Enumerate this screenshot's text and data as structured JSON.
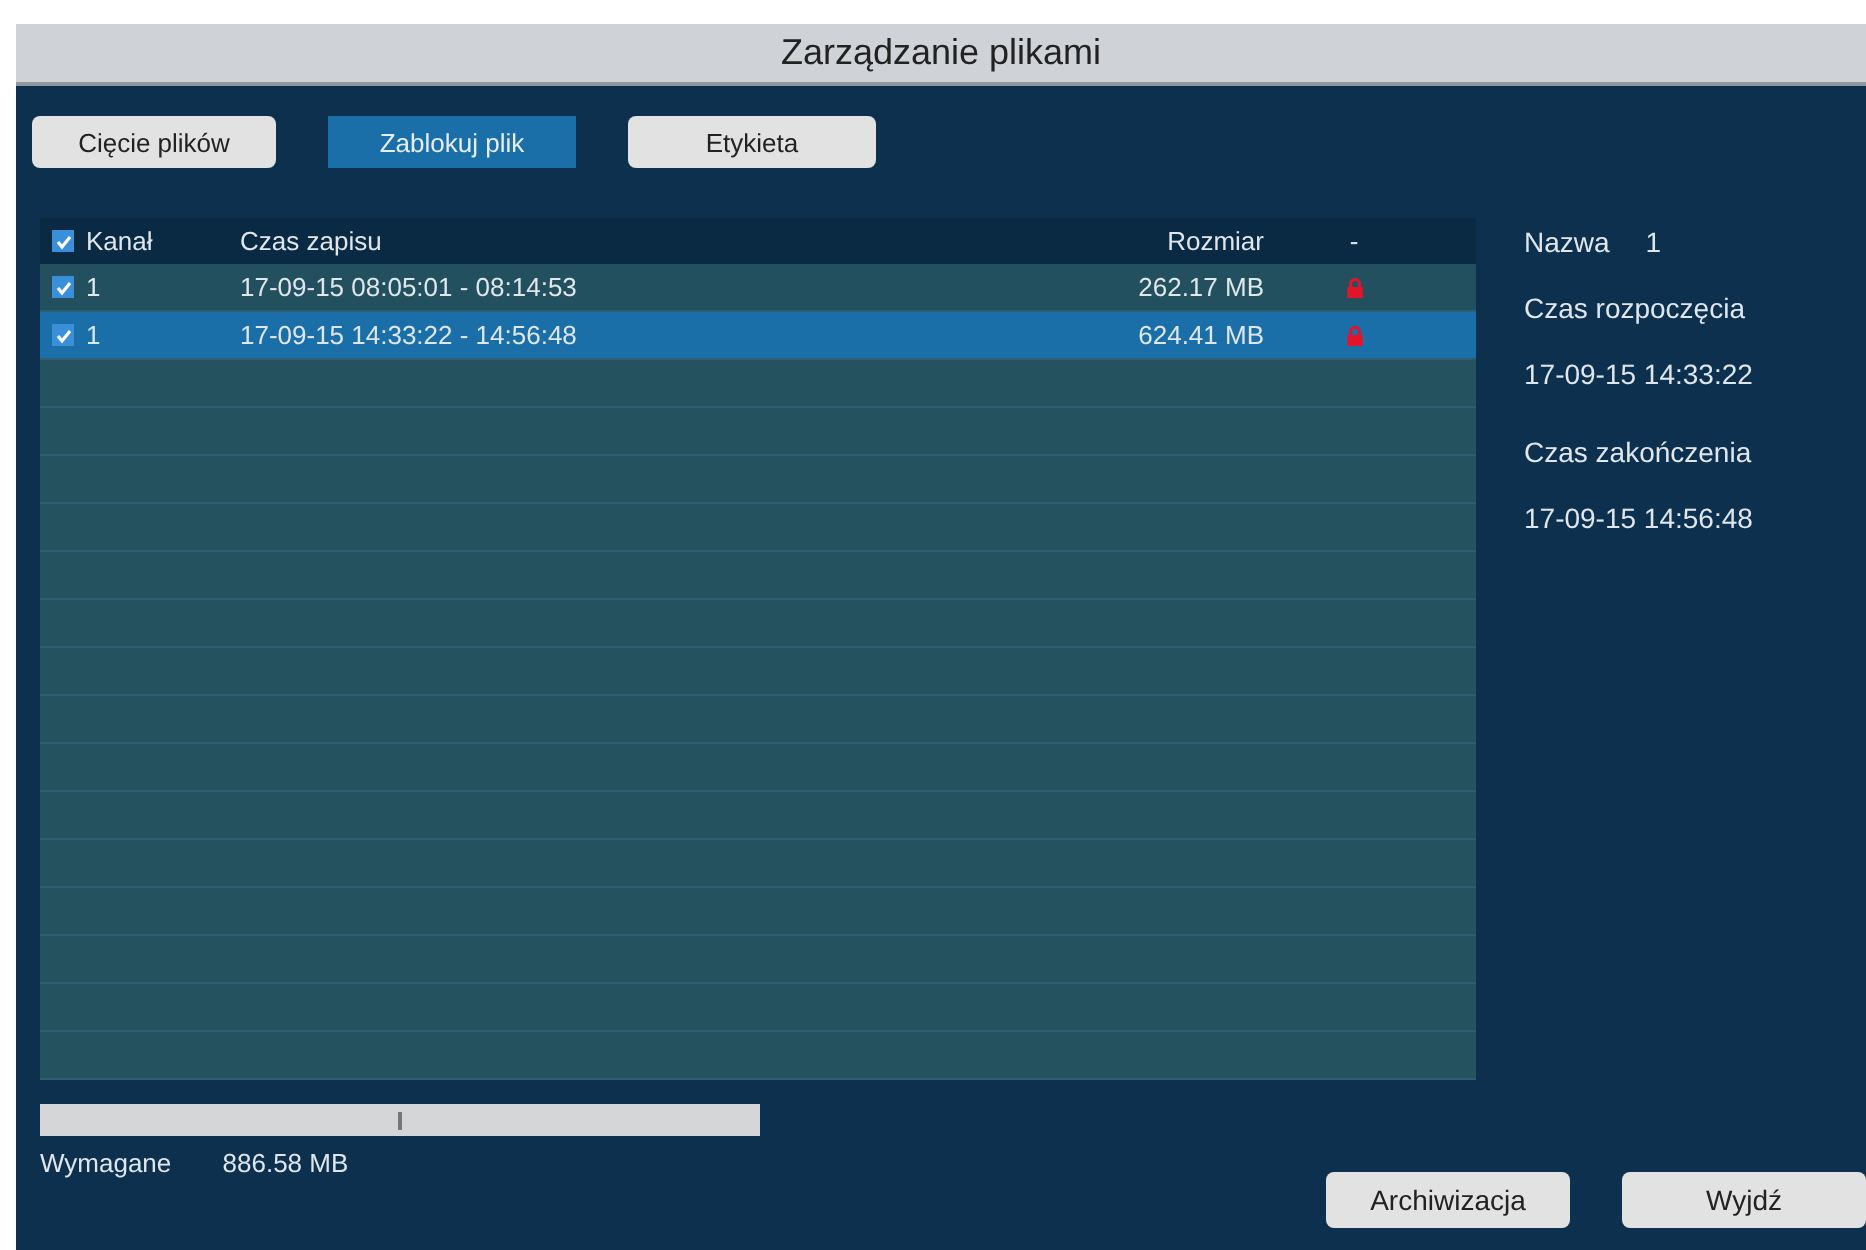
{
  "window": {
    "title": "Zarządzanie plikami"
  },
  "toolbar": [
    {
      "label": "Cięcie plików",
      "selected": false
    },
    {
      "label": "Zablokuj plik",
      "selected": true
    },
    {
      "label": "Etykieta",
      "selected": false
    }
  ],
  "table": {
    "header_checked": true,
    "columns": [
      "Kanał",
      "Czas zapisu",
      "Rozmiar",
      "-"
    ],
    "rows": [
      {
        "checked": true,
        "selected": false,
        "channel": "1",
        "time": "17-09-15 08:05:01 - 08:14:53",
        "size": "262.17 MB",
        "locked": true
      },
      {
        "checked": true,
        "selected": true,
        "channel": "1",
        "time": "17-09-15 14:33:22 - 14:56:48",
        "size": "624.41 MB",
        "locked": true
      }
    ]
  },
  "details": {
    "name_label": "Nazwa",
    "name_value": "1",
    "start_label": "Czas rozpoczęcia",
    "start_value": "17-09-15 14:33:22",
    "end_label": "Czas zakończenia",
    "end_value": "17-09-15 14:56:48"
  },
  "footer": {
    "required_label": "Wymagane",
    "required_value": "886.58 MB",
    "buttons": [
      "Archiwizacja",
      "Wyjdź"
    ]
  }
}
